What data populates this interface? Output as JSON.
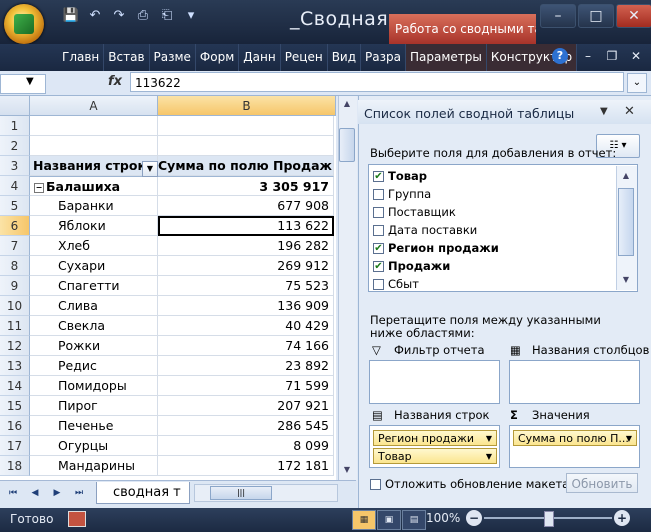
{
  "window": {
    "title": "_Своднaя...",
    "contextual_tab_group": "Работа со сводными та..."
  },
  "quick_access": [
    "save-icon",
    "undo-icon",
    "redo-icon",
    "print-preview-icon",
    "print-icon",
    "customize-icon"
  ],
  "ribbon": {
    "tabs": [
      "Главн",
      "Встав",
      "Разме",
      "Форм",
      "Данн",
      "Рецен",
      "Вид",
      "Разра",
      "Параметры",
      "Конструктор"
    ]
  },
  "formula_bar": {
    "fx": "fx",
    "value": "113622"
  },
  "sheet": {
    "col_headers": [
      "A",
      "B"
    ],
    "row_numbers": [
      "1",
      "2",
      "3",
      "4",
      "5",
      "6",
      "7",
      "8",
      "9",
      "10",
      "11",
      "12",
      "13",
      "14",
      "15",
      "16",
      "17",
      "18"
    ],
    "header_row": {
      "a": "Названия строк",
      "b": "Сумма по полю Продажи"
    },
    "group_row": {
      "a": "Балашиха",
      "b": "3 305 917"
    },
    "items": [
      {
        "name": "Баранки",
        "value": "677 908"
      },
      {
        "name": "Яблоки",
        "value": "113 622"
      },
      {
        "name": "Хлеб",
        "value": "196 282"
      },
      {
        "name": "Сухари",
        "value": "269 912"
      },
      {
        "name": "Спагетти",
        "value": "75 523"
      },
      {
        "name": "Слива",
        "value": "136 909"
      },
      {
        "name": "Свекла",
        "value": "40 429"
      },
      {
        "name": "Рожки",
        "value": "74 166"
      },
      {
        "name": "Редис",
        "value": "23 892"
      },
      {
        "name": "Помидоры",
        "value": "71 599"
      },
      {
        "name": "Пирог",
        "value": "207 921"
      },
      {
        "name": "Печенье",
        "value": "286 545"
      },
      {
        "name": "Огурцы",
        "value": "8 099"
      },
      {
        "name": "Мандарины",
        "value": "172 181"
      }
    ],
    "sheet_tab": "сводная т"
  },
  "pivot_pane": {
    "title": "Список полей сводной таблицы",
    "choose_label": "Выберите поля для добавления в отчет:",
    "fields": [
      {
        "label": "Товар",
        "checked": true
      },
      {
        "label": "Группа",
        "checked": false
      },
      {
        "label": "Поставщик",
        "checked": false
      },
      {
        "label": "Дата поставки",
        "checked": false
      },
      {
        "label": "Регион продажи",
        "checked": true
      },
      {
        "label": "Продажи",
        "checked": true
      },
      {
        "label": "Сбыт",
        "checked": false
      }
    ],
    "drag_label": "Перетащите поля между указанными ниже областями:",
    "areas": {
      "report_filter": "Фильтр отчета",
      "column_labels": "Названия столбцов",
      "row_labels": "Названия строк",
      "values": "Значения"
    },
    "row_pills": [
      "Регион продажи",
      "Товар"
    ],
    "value_pills": [
      "Сумма по полю П..."
    ],
    "defer_label": "Отложить обновление макета",
    "update_button": "Обновить"
  },
  "status_bar": {
    "status": "Готово",
    "zoom": "100%",
    "zoom_level_percent": 100
  }
}
